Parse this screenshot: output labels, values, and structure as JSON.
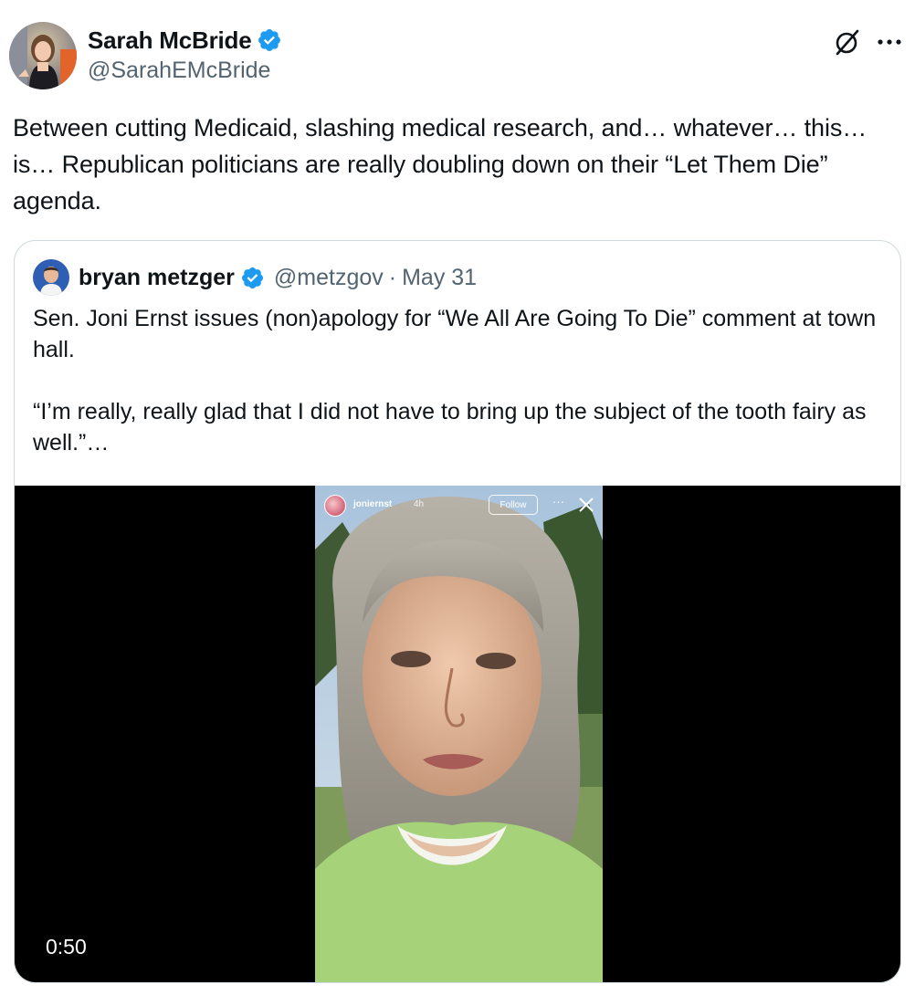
{
  "post": {
    "author": {
      "display_name": "Sarah McBride",
      "handle": "@SarahEMcBride",
      "verified": true
    },
    "text": "Between cutting Medicaid, slashing medical research, and… whatever… this… is… Republican politicians are really doubling down on their “Let Them Die” agenda.",
    "actions": {
      "grok_icon": "grok-icon",
      "more_icon": "more-icon"
    }
  },
  "quoted_post": {
    "author": {
      "display_name": "bryan metzger",
      "handle": "@metzgov",
      "verified": true
    },
    "separator": "·",
    "date": "May 31",
    "paragraph_1": "Sen. Joni Ernst issues (non)apology for “We All Are Going To Die” comment at town hall.",
    "paragraph_2": "“I’m really, really glad that I did not have to bring up the subject of the tooth fairy as well.”…",
    "video": {
      "duration": "0:50",
      "story_overlay": {
        "username": "joniernst",
        "time": "4h",
        "follow_label": "Follow",
        "more_glyph": "···"
      }
    }
  },
  "colors": {
    "text_primary": "#0f1419",
    "text_secondary": "#536471",
    "verified_blue": "#1d9bf0",
    "border": "#cfd9de"
  }
}
